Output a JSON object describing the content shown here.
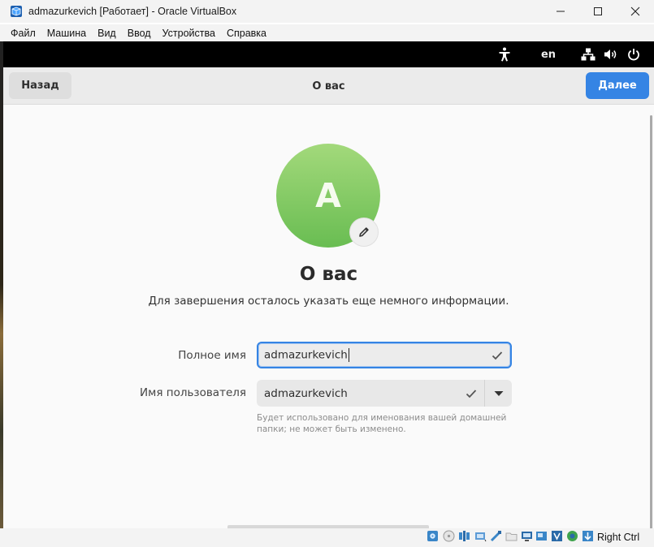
{
  "window": {
    "title": "admazurkevich [Работает] - Oracle VirtualBox",
    "menu": [
      "Файл",
      "Машина",
      "Вид",
      "Ввод",
      "Устройства",
      "Справка"
    ]
  },
  "gnome_topbar": {
    "language": "en",
    "icons": [
      "accessibility-icon",
      "network-icon",
      "volume-icon",
      "power-icon"
    ]
  },
  "headerbar": {
    "back_label": "Назад",
    "title": "О вас",
    "next_label": "Далее",
    "accent_color": "#3584e4"
  },
  "page": {
    "avatar_letter": "A",
    "title": "О вас",
    "subtitle": "Для завершения осталось указать еще немного информации.",
    "full_name_label": "Полное имя",
    "full_name_value": "admazurkevich",
    "username_label": "Имя пользователя",
    "username_value": "admazurkevich",
    "hint": "Будет использовано для именования вашей домашней папки; не может быть изменено."
  },
  "statusbar": {
    "host_key": "Right Ctrl"
  }
}
